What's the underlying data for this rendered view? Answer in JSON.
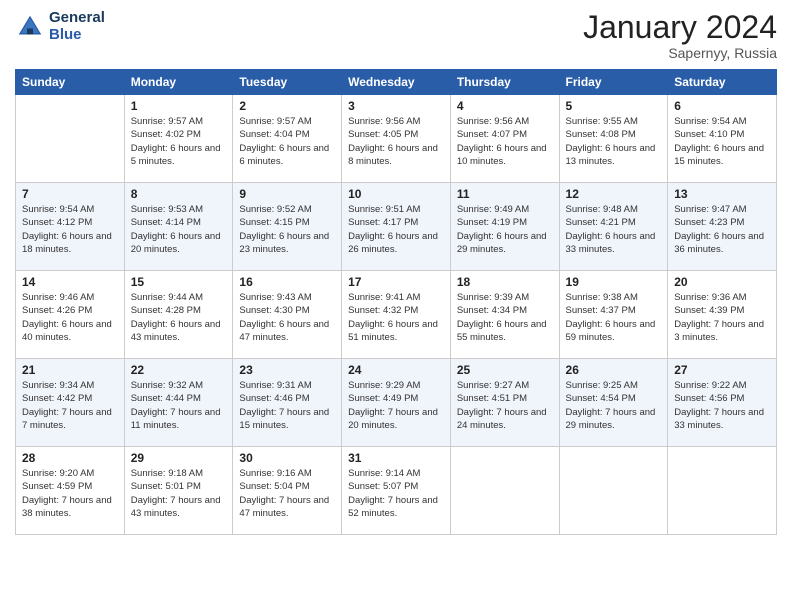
{
  "header": {
    "logo_line1": "General",
    "logo_line2": "Blue",
    "month_title": "January 2024",
    "location": "Sapernyy, Russia"
  },
  "weekdays": [
    "Sunday",
    "Monday",
    "Tuesday",
    "Wednesday",
    "Thursday",
    "Friday",
    "Saturday"
  ],
  "weeks": [
    [
      {
        "day": "",
        "sunrise": "",
        "sunset": "",
        "daylight": ""
      },
      {
        "day": "1",
        "sunrise": "Sunrise: 9:57 AM",
        "sunset": "Sunset: 4:02 PM",
        "daylight": "Daylight: 6 hours and 5 minutes."
      },
      {
        "day": "2",
        "sunrise": "Sunrise: 9:57 AM",
        "sunset": "Sunset: 4:04 PM",
        "daylight": "Daylight: 6 hours and 6 minutes."
      },
      {
        "day": "3",
        "sunrise": "Sunrise: 9:56 AM",
        "sunset": "Sunset: 4:05 PM",
        "daylight": "Daylight: 6 hours and 8 minutes."
      },
      {
        "day": "4",
        "sunrise": "Sunrise: 9:56 AM",
        "sunset": "Sunset: 4:07 PM",
        "daylight": "Daylight: 6 hours and 10 minutes."
      },
      {
        "day": "5",
        "sunrise": "Sunrise: 9:55 AM",
        "sunset": "Sunset: 4:08 PM",
        "daylight": "Daylight: 6 hours and 13 minutes."
      },
      {
        "day": "6",
        "sunrise": "Sunrise: 9:54 AM",
        "sunset": "Sunset: 4:10 PM",
        "daylight": "Daylight: 6 hours and 15 minutes."
      }
    ],
    [
      {
        "day": "7",
        "sunrise": "Sunrise: 9:54 AM",
        "sunset": "Sunset: 4:12 PM",
        "daylight": "Daylight: 6 hours and 18 minutes."
      },
      {
        "day": "8",
        "sunrise": "Sunrise: 9:53 AM",
        "sunset": "Sunset: 4:14 PM",
        "daylight": "Daylight: 6 hours and 20 minutes."
      },
      {
        "day": "9",
        "sunrise": "Sunrise: 9:52 AM",
        "sunset": "Sunset: 4:15 PM",
        "daylight": "Daylight: 6 hours and 23 minutes."
      },
      {
        "day": "10",
        "sunrise": "Sunrise: 9:51 AM",
        "sunset": "Sunset: 4:17 PM",
        "daylight": "Daylight: 6 hours and 26 minutes."
      },
      {
        "day": "11",
        "sunrise": "Sunrise: 9:49 AM",
        "sunset": "Sunset: 4:19 PM",
        "daylight": "Daylight: 6 hours and 29 minutes."
      },
      {
        "day": "12",
        "sunrise": "Sunrise: 9:48 AM",
        "sunset": "Sunset: 4:21 PM",
        "daylight": "Daylight: 6 hours and 33 minutes."
      },
      {
        "day": "13",
        "sunrise": "Sunrise: 9:47 AM",
        "sunset": "Sunset: 4:23 PM",
        "daylight": "Daylight: 6 hours and 36 minutes."
      }
    ],
    [
      {
        "day": "14",
        "sunrise": "Sunrise: 9:46 AM",
        "sunset": "Sunset: 4:26 PM",
        "daylight": "Daylight: 6 hours and 40 minutes."
      },
      {
        "day": "15",
        "sunrise": "Sunrise: 9:44 AM",
        "sunset": "Sunset: 4:28 PM",
        "daylight": "Daylight: 6 hours and 43 minutes."
      },
      {
        "day": "16",
        "sunrise": "Sunrise: 9:43 AM",
        "sunset": "Sunset: 4:30 PM",
        "daylight": "Daylight: 6 hours and 47 minutes."
      },
      {
        "day": "17",
        "sunrise": "Sunrise: 9:41 AM",
        "sunset": "Sunset: 4:32 PM",
        "daylight": "Daylight: 6 hours and 51 minutes."
      },
      {
        "day": "18",
        "sunrise": "Sunrise: 9:39 AM",
        "sunset": "Sunset: 4:34 PM",
        "daylight": "Daylight: 6 hours and 55 minutes."
      },
      {
        "day": "19",
        "sunrise": "Sunrise: 9:38 AM",
        "sunset": "Sunset: 4:37 PM",
        "daylight": "Daylight: 6 hours and 59 minutes."
      },
      {
        "day": "20",
        "sunrise": "Sunrise: 9:36 AM",
        "sunset": "Sunset: 4:39 PM",
        "daylight": "Daylight: 7 hours and 3 minutes."
      }
    ],
    [
      {
        "day": "21",
        "sunrise": "Sunrise: 9:34 AM",
        "sunset": "Sunset: 4:42 PM",
        "daylight": "Daylight: 7 hours and 7 minutes."
      },
      {
        "day": "22",
        "sunrise": "Sunrise: 9:32 AM",
        "sunset": "Sunset: 4:44 PM",
        "daylight": "Daylight: 7 hours and 11 minutes."
      },
      {
        "day": "23",
        "sunrise": "Sunrise: 9:31 AM",
        "sunset": "Sunset: 4:46 PM",
        "daylight": "Daylight: 7 hours and 15 minutes."
      },
      {
        "day": "24",
        "sunrise": "Sunrise: 9:29 AM",
        "sunset": "Sunset: 4:49 PM",
        "daylight": "Daylight: 7 hours and 20 minutes."
      },
      {
        "day": "25",
        "sunrise": "Sunrise: 9:27 AM",
        "sunset": "Sunset: 4:51 PM",
        "daylight": "Daylight: 7 hours and 24 minutes."
      },
      {
        "day": "26",
        "sunrise": "Sunrise: 9:25 AM",
        "sunset": "Sunset: 4:54 PM",
        "daylight": "Daylight: 7 hours and 29 minutes."
      },
      {
        "day": "27",
        "sunrise": "Sunrise: 9:22 AM",
        "sunset": "Sunset: 4:56 PM",
        "daylight": "Daylight: 7 hours and 33 minutes."
      }
    ],
    [
      {
        "day": "28",
        "sunrise": "Sunrise: 9:20 AM",
        "sunset": "Sunset: 4:59 PM",
        "daylight": "Daylight: 7 hours and 38 minutes."
      },
      {
        "day": "29",
        "sunrise": "Sunrise: 9:18 AM",
        "sunset": "Sunset: 5:01 PM",
        "daylight": "Daylight: 7 hours and 43 minutes."
      },
      {
        "day": "30",
        "sunrise": "Sunrise: 9:16 AM",
        "sunset": "Sunset: 5:04 PM",
        "daylight": "Daylight: 7 hours and 47 minutes."
      },
      {
        "day": "31",
        "sunrise": "Sunrise: 9:14 AM",
        "sunset": "Sunset: 5:07 PM",
        "daylight": "Daylight: 7 hours and 52 minutes."
      },
      {
        "day": "",
        "sunrise": "",
        "sunset": "",
        "daylight": ""
      },
      {
        "day": "",
        "sunrise": "",
        "sunset": "",
        "daylight": ""
      },
      {
        "day": "",
        "sunrise": "",
        "sunset": "",
        "daylight": ""
      }
    ]
  ]
}
